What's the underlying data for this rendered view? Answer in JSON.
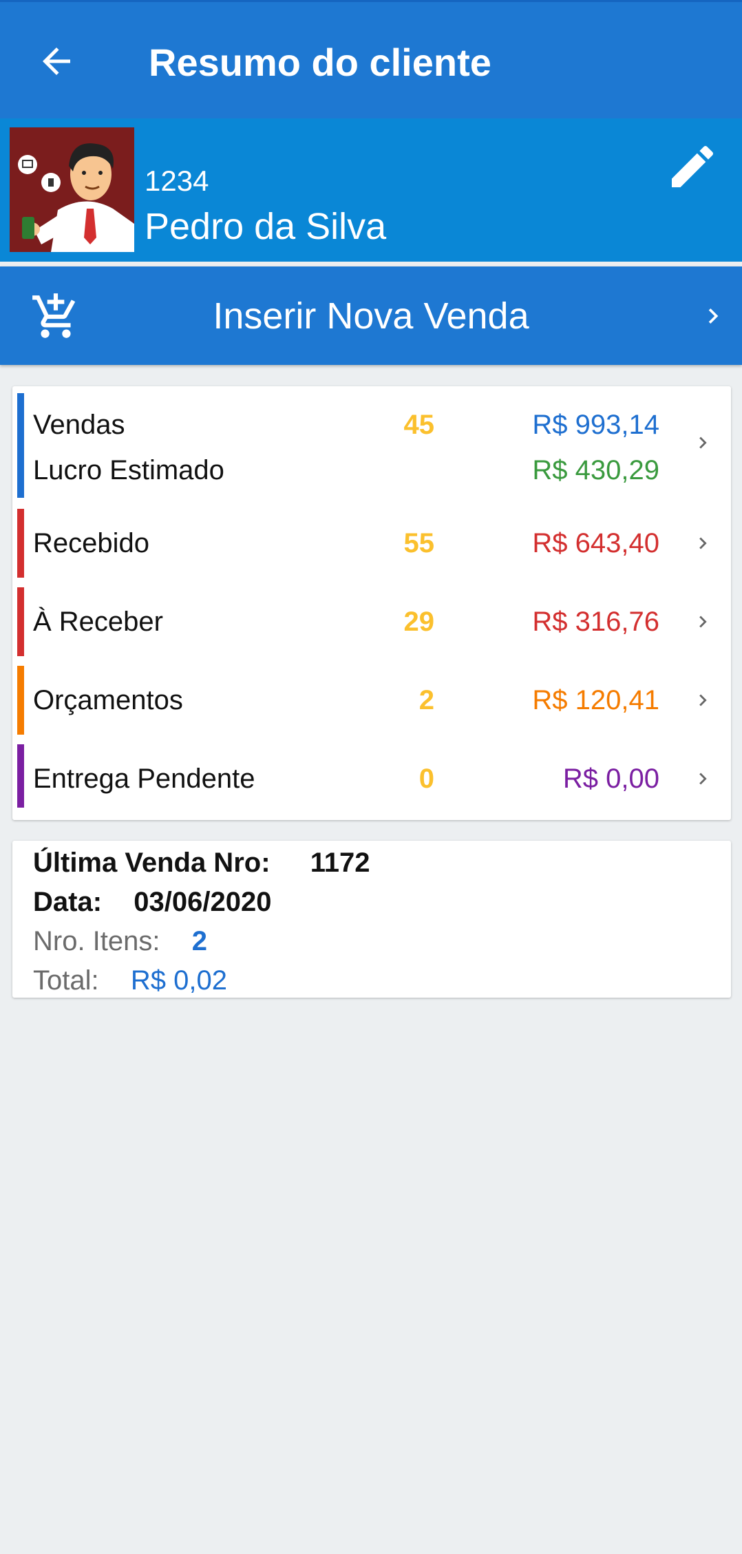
{
  "header": {
    "title": "Resumo do cliente",
    "back_icon": "arrow-back-icon"
  },
  "client": {
    "code": "1234",
    "name": "Pedro da Silva",
    "edit_icon": "pencil-icon"
  },
  "new_sale": {
    "label": "Inserir Nova Venda",
    "icon": "add-shopping-cart-icon"
  },
  "summary": {
    "sales": {
      "label": "Vendas",
      "count": "45",
      "value": "R$ 993,14",
      "color": "#1e6fd0"
    },
    "profit": {
      "label": "Lucro Estimado",
      "value": "R$ 430,29",
      "color": "#3a9a3e"
    },
    "received": {
      "label": "Recebido",
      "count": "55",
      "value": "R$ 643,40",
      "color": "#d32f2f"
    },
    "to_receive": {
      "label": "À Receber",
      "count": "29",
      "value": "R$ 316,76",
      "color": "#d32f2f"
    },
    "quotes": {
      "label": "Orçamentos",
      "count": "2",
      "value": "R$ 120,41",
      "color": "#f57c00"
    },
    "pending_delivery": {
      "label": "Entrega Pendente",
      "count": "0",
      "value": "R$ 0,00",
      "color": "#7b1fa2"
    },
    "count_color": "#fbc02d",
    "bar_colors": {
      "sales": "#1e6fd0",
      "received": "#d32f2f",
      "to_receive": "#d32f2f",
      "quotes": "#f57c00",
      "pending_delivery": "#7b1fa2"
    }
  },
  "last_sale": {
    "number_label": "Última Venda Nro:",
    "number": "1172",
    "date_label": "Data:",
    "date": "03/06/2020",
    "items_label": "Nro. Itens:",
    "items": "2",
    "total_label": "Total:",
    "total": "R$ 0,02"
  }
}
